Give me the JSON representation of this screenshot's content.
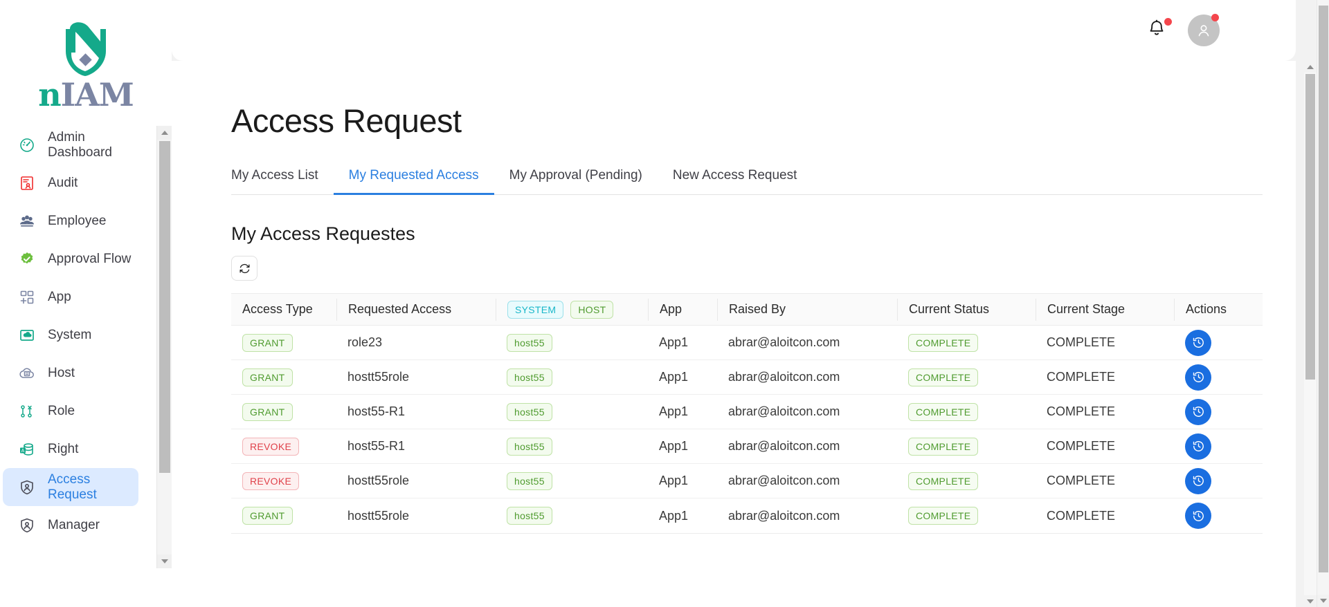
{
  "brand": {
    "logo_text_part1": "n",
    "logo_text_part2": "IAM",
    "logo_icon": "niam-leaf-logo",
    "teal": "#14a98a",
    "slate": "#7b85a3"
  },
  "sidebar": {
    "items": [
      {
        "label": "Admin Dashboard",
        "icon": "speedometer-icon",
        "active": false
      },
      {
        "label": "Audit",
        "icon": "audit-report-icon",
        "active": false
      },
      {
        "label": "Employee",
        "icon": "people-group-icon",
        "active": false
      },
      {
        "label": "Approval Flow",
        "icon": "check-badge-icon",
        "active": false
      },
      {
        "label": "App",
        "icon": "app-grid-plus-icon",
        "active": false
      },
      {
        "label": "System",
        "icon": "cloud-screen-icon",
        "active": false
      },
      {
        "label": "Host",
        "icon": "cloud-server-icon",
        "active": false
      },
      {
        "label": "Role",
        "icon": "role-nodes-icon",
        "active": false
      },
      {
        "label": "Right",
        "icon": "database-a-icon",
        "active": false
      },
      {
        "label": "Access Request",
        "icon": "shield-user-icon",
        "active": true
      },
      {
        "label": "Manager",
        "icon": "shield-user-icon",
        "active": false
      }
    ]
  },
  "topbar": {
    "notification_icon": "bell-icon",
    "notification_badge": true,
    "avatar_icon": "user-avatar-icon",
    "avatar_badge": true
  },
  "page": {
    "title": "Access Request",
    "tabs": [
      {
        "label": "My Access List",
        "active": false
      },
      {
        "label": "My Requested Access",
        "active": true
      },
      {
        "label": "My Approval (Pending)",
        "active": false
      },
      {
        "label": "New Access Request",
        "active": false
      }
    ],
    "section_title": "My Access Requestes",
    "refresh_icon": "refresh-icon",
    "accent_color": "#2b7fe0"
  },
  "table": {
    "columns": [
      {
        "key": "access_type",
        "label": "Access Type"
      },
      {
        "key": "requested_access",
        "label": "Requested Access"
      },
      {
        "key": "system_host",
        "label": "",
        "badges": [
          {
            "text": "SYSTEM",
            "style": "system"
          },
          {
            "text": "HOST",
            "style": "host"
          }
        ]
      },
      {
        "key": "app",
        "label": "App"
      },
      {
        "key": "raised_by",
        "label": "Raised By"
      },
      {
        "key": "current_status",
        "label": "Current Status"
      },
      {
        "key": "current_stage",
        "label": "Current Stage"
      },
      {
        "key": "actions",
        "label": "Actions"
      }
    ],
    "rows": [
      {
        "access_type": "GRANT",
        "access_type_style": "grant",
        "requested_access": "role23",
        "system_host": "host55",
        "app": "App1",
        "raised_by": "abrar@aloitcon.com",
        "current_status": "COMPLETE",
        "current_stage": "COMPLETE",
        "action_icon": "history-clock-icon"
      },
      {
        "access_type": "GRANT",
        "access_type_style": "grant",
        "requested_access": "hostt55role",
        "system_host": "host55",
        "app": "App1",
        "raised_by": "abrar@aloitcon.com",
        "current_status": "COMPLETE",
        "current_stage": "COMPLETE",
        "action_icon": "history-clock-icon"
      },
      {
        "access_type": "GRANT",
        "access_type_style": "grant",
        "requested_access": "host55-R1",
        "system_host": "host55",
        "app": "App1",
        "raised_by": "abrar@aloitcon.com",
        "current_status": "COMPLETE",
        "current_stage": "COMPLETE",
        "action_icon": "history-clock-icon"
      },
      {
        "access_type": "REVOKE",
        "access_type_style": "revoke",
        "requested_access": "host55-R1",
        "system_host": "host55",
        "app": "App1",
        "raised_by": "abrar@aloitcon.com",
        "current_status": "COMPLETE",
        "current_stage": "COMPLETE",
        "action_icon": "history-clock-icon"
      },
      {
        "access_type": "REVOKE",
        "access_type_style": "revoke",
        "requested_access": "hostt55role",
        "system_host": "host55",
        "app": "App1",
        "raised_by": "abrar@aloitcon.com",
        "current_status": "COMPLETE",
        "current_stage": "COMPLETE",
        "action_icon": "history-clock-icon"
      },
      {
        "access_type": "GRANT",
        "access_type_style": "grant",
        "requested_access": "hostt55role",
        "system_host": "host55",
        "app": "App1",
        "raised_by": "abrar@aloitcon.com",
        "current_status": "COMPLETE",
        "current_stage": "COMPLETE",
        "action_icon": "history-clock-icon"
      }
    ]
  }
}
